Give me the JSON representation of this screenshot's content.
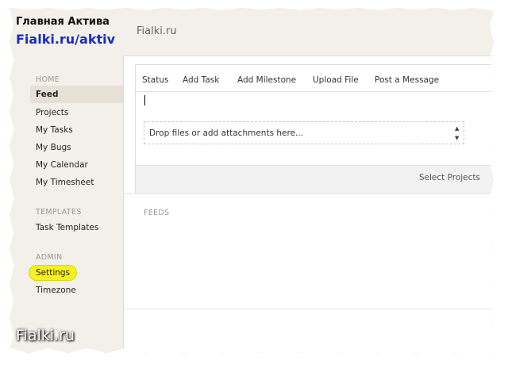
{
  "brand": {
    "title": "Главная Актива",
    "url": "Fialki.ru/aktiv",
    "app_name": "Fialki.ru",
    "watermark": "Fialki.ru"
  },
  "sidebar": {
    "home_title": "HOME",
    "home_items": [
      "Feed",
      "Projects",
      "My Tasks",
      "My Bugs",
      "My Calendar",
      "My Timesheet"
    ],
    "templates_title": "TEMPLATES",
    "templates_items": [
      "Task Templates"
    ],
    "admin_title": "ADMIN",
    "admin_items": [
      "Settings",
      "Timezone"
    ],
    "active_item": "Feed",
    "highlight_color": "#f7f21e"
  },
  "composer": {
    "tabs": [
      "Status",
      "Add Task",
      "Add Milestone",
      "Upload File",
      "Post a Message"
    ],
    "active_tab": "Status",
    "input_value": "",
    "drop_zone_text": "Drop files or add attachments here...",
    "select_projects_label": "Select Projects"
  },
  "feeds": {
    "label": "FEEDS"
  },
  "colors": {
    "brand_blue": "#1a2bbf",
    "sidebar_bg": "#f3f0ea"
  }
}
